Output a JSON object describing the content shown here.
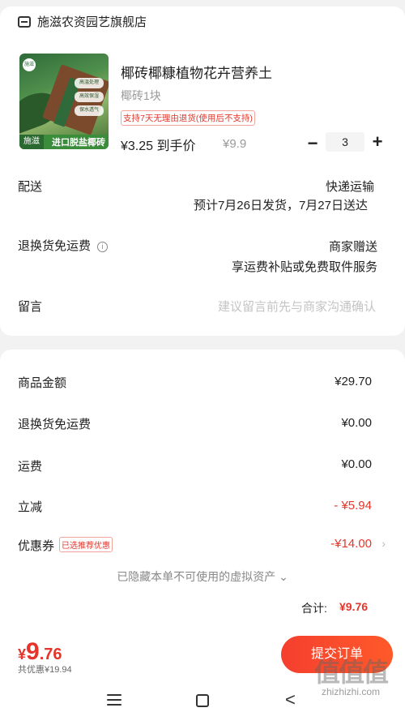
{
  "shop": {
    "name": "施滋农资园艺旗舰店",
    "icon": "store-icon"
  },
  "product": {
    "title": "椰砖椰糠植物花卉营养土",
    "spec": "椰砖1块",
    "return_tag": "支持7天无理由退货(使用后不支持)",
    "price": "¥3.25 到手价",
    "original_price": "¥9.9",
    "quantity": "3",
    "minus": "−",
    "plus": "+",
    "image": {
      "brand": "施滋",
      "banner": "进口脱盐椰砖",
      "logo": "施滋",
      "badges": [
        "高温处理",
        "高效保湿",
        "保水透气"
      ]
    }
  },
  "delivery": {
    "label": "配送",
    "method": "快递运输",
    "estimate": "预计7月26日发货，7月27日送达"
  },
  "return_shipping": {
    "label": "退换货免运费",
    "info_icon": "i",
    "value": "商家赠送",
    "detail": "享运费补贴或免费取件服务"
  },
  "message": {
    "label": "留言",
    "placeholder": "建议留言前先与商家沟通确认"
  },
  "summary": {
    "goods_label": "商品金额",
    "goods_value": "¥29.70",
    "return_label": "退换货免运费",
    "return_value": "¥0.00",
    "shipping_label": "运费",
    "shipping_value": "¥0.00",
    "discount_label": "立减",
    "discount_value": "- ¥5.94",
    "coupon_label": "优惠券",
    "coupon_tag": "已选推荐优惠",
    "coupon_value": "-¥14.00",
    "chevron": "›",
    "hidden_note": "已隐藏本单不可使用的虚拟资产 ⌄",
    "total_label": "合计:",
    "total_value": "¥9.76"
  },
  "footer": {
    "yen": "¥",
    "int": "9",
    "dec": ".76",
    "saved": "共优惠¥19.94",
    "submit": "提交订单"
  },
  "watermark": {
    "glyphs": "值值值",
    "text": "zhizhizhi.com"
  },
  "colors": {
    "accent": "#e5352b",
    "muted": "#999999"
  }
}
